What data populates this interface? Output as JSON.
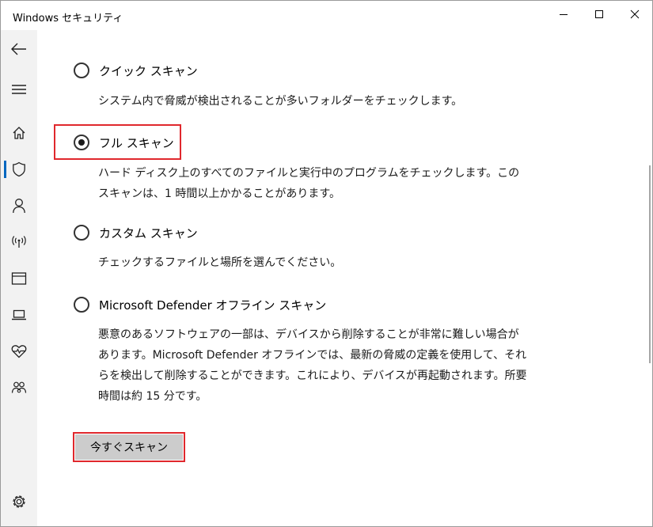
{
  "window": {
    "title": "Windows セキュリティ"
  },
  "controls": {
    "minimize": "minimize-icon",
    "maximize": "maximize-icon",
    "close": "close-icon"
  },
  "sidebar": {
    "items": [
      {
        "icon": "back-arrow-icon"
      },
      {
        "icon": "hamburger-menu-icon"
      },
      {
        "icon": "home-icon"
      },
      {
        "icon": "shield-icon",
        "selected": true
      },
      {
        "icon": "person-icon"
      },
      {
        "icon": "wireless-antenna-icon"
      },
      {
        "icon": "app-browser-window-icon"
      },
      {
        "icon": "laptop-icon"
      },
      {
        "icon": "heart-pulse-icon"
      },
      {
        "icon": "family-icon"
      },
      {
        "icon": "gear-icon"
      }
    ]
  },
  "scan_options": [
    {
      "label": "クイック スキャン",
      "checked": false,
      "description": "システム内で脅威が検出されることが多いフォルダーをチェックします。"
    },
    {
      "label": "フル スキャン",
      "checked": true,
      "description": "ハード ディスク上のすべてのファイルと実行中のプログラムをチェックします。このスキャンは、1 時間以上かかることがあります。"
    },
    {
      "label": "カスタム スキャン",
      "checked": false,
      "description": "チェックするファイルと場所を選んでください。"
    },
    {
      "label": "Microsoft Defender オフライン スキャン",
      "checked": false,
      "description": "悪意のあるソフトウェアの一部は、デバイスから削除することが非常に難しい場合があります。Microsoft Defender オフラインでは、最新の脅威の定義を使用して、それらを検出して削除することができます。これにより、デバイスが再起動されます。所要時間は約 15 分です。"
    }
  ],
  "scan_button": {
    "label": "今すぐスキャン"
  },
  "colors": {
    "highlight": "#e0282d",
    "accent": "#0067c0",
    "sidebar_bg": "#f2f2f2",
    "button_bg": "#cccccc"
  }
}
